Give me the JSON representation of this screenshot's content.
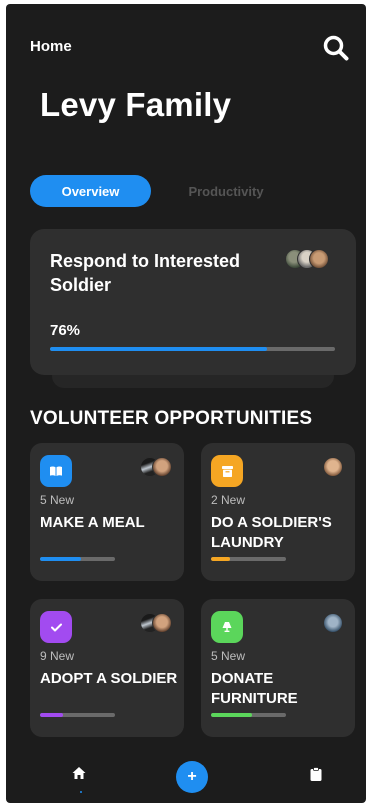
{
  "header": {
    "home_label": "Home",
    "icon": "search-icon"
  },
  "page_title": "Levy Family",
  "tabs": [
    {
      "label": "Overview",
      "active": true
    },
    {
      "label": "Productivity",
      "active": false
    }
  ],
  "task_card": {
    "title": "Respond to Interested Soldier",
    "progress_label": "76%",
    "progress": 0.76,
    "color": "#1f8ef1"
  },
  "section_title": "VOLUNTEER OPPORTUNITIES",
  "opportunities": [
    {
      "badge": "5 New",
      "title": "MAKE A MEAL",
      "color": "#1f8ef1",
      "icon": "book-icon",
      "progress": 0.55
    },
    {
      "badge": "2 New",
      "title": "DO A SOLDIER'S LAUNDRY",
      "color": "#f5a623",
      "icon": "box-icon",
      "progress": 0.25
    },
    {
      "badge": "9 New",
      "title": "ADOPT A SOLDIER",
      "color": "#a24bf0",
      "icon": "check-icon",
      "progress": 0.3
    },
    {
      "badge": "5 New",
      "title": "DONATE FURNITURE",
      "color": "#5bd65b",
      "icon": "lamp-icon",
      "progress": 0.55
    }
  ],
  "bottom_nav": {
    "home_icon": "home-icon",
    "add_label": "+",
    "clipboard_icon": "clipboard-icon",
    "accent": "#1f8ef1"
  }
}
